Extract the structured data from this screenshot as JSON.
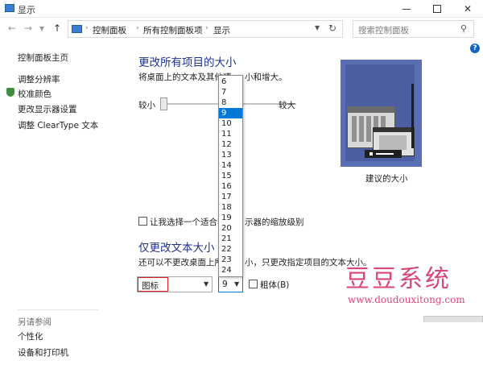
{
  "window": {
    "title": "显示",
    "min_icon": "minimize-icon",
    "max_icon": "maximize-icon",
    "close_icon": "close-icon"
  },
  "address_bar": {
    "breadcrumb": [
      "控制面板",
      "所有控制面板项",
      "显示"
    ],
    "search_placeholder": "搜索控制面板"
  },
  "sidebar": {
    "items": [
      "控制面板主页",
      "调整分辨率",
      "校准颜色",
      "更改显示器设置",
      "调整 ClearType 文本"
    ],
    "see_also_title": "另请参阅",
    "see_also_items": [
      "个性化",
      "设备和打印机"
    ]
  },
  "main": {
    "heading1": "更改所有项目的大小",
    "desc1_left": "将桌面上的文本及其他项",
    "desc1_right": "小和增大。",
    "slider_min": "较小",
    "slider_max": "较大",
    "preview_caption": "建议的大小",
    "custom_scale_left": "让我选择一个适合我的",
    "custom_scale_right": "示器的缩放级别",
    "heading2": "仅更改文本大小",
    "desc2_left": "还可以不更改桌面上所有",
    "desc2_right": "小，只更改指定项目的文本大小。",
    "item_select_value": "图标",
    "size_select_value": "9",
    "bold_label": "粗体(B)"
  },
  "dropdown": {
    "options": [
      "6",
      "7",
      "8",
      "9",
      "10",
      "11",
      "12",
      "13",
      "14",
      "15",
      "16",
      "17",
      "18",
      "19",
      "20",
      "21",
      "22",
      "23",
      "24"
    ],
    "selected": "9"
  },
  "watermark": {
    "text": "豆豆系统",
    "url": "www.doudouxitong.com"
  },
  "colors": {
    "heading": "#1e3287",
    "selection": "#0078d7",
    "watermark": "#d7467c",
    "highlight_border": "#e02020"
  }
}
